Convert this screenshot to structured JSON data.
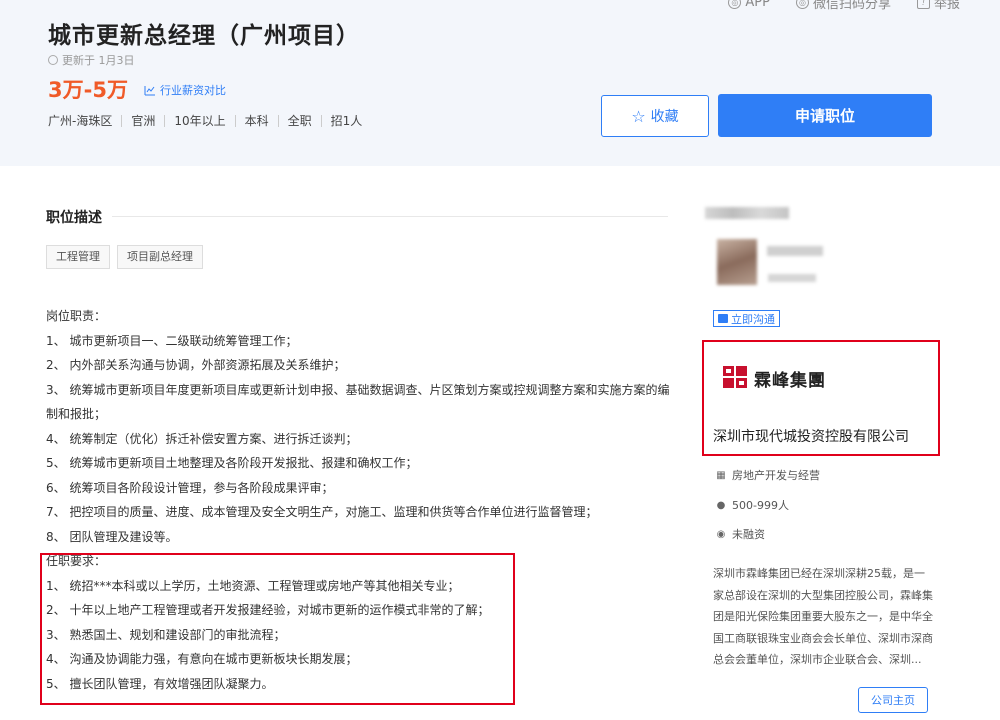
{
  "top_actions": {
    "app": "APP",
    "wechat_share": "微信扫码分享",
    "report": "举报"
  },
  "job": {
    "title": "城市更新总经理（广州项目）",
    "updated": "更新于 1月3日",
    "salary": "3万-5万",
    "salary_compare": "行业薪资对比",
    "attributes": [
      "广州-海珠区",
      "官洲",
      "10年以上",
      "本科",
      "全职",
      "招1人"
    ]
  },
  "buttons": {
    "favorite": "收藏",
    "apply": "申请职位"
  },
  "description": {
    "section_title": "职位描述",
    "keywords": [
      "工程管理",
      "项目副总经理"
    ],
    "duties_heading": "岗位职责：",
    "duties": [
      "1、 城市更新项目一、二级联动统筹管理工作；",
      "2、 内外部关系沟通与协调，外部资源拓展及关系维护；",
      "3、 统筹城市更新项目年度更新项目库或更新计划申报、基础数据调查、片区策划方案或控规调整方案和实施方案的编制和报批；",
      "4、 统筹制定（优化）拆迁补偿安置方案、进行拆迁谈判；",
      "5、 统筹城市更新项目土地整理及各阶段开发报批、报建和确权工作；",
      "6、 统筹项目各阶段设计管理，参与各阶段成果评审；",
      "7、 把控项目的质量、进度、成本管理及安全文明生产，对施工、监理和供货等合作单位进行监督管理；",
      "8、 团队管理及建设等。"
    ],
    "requirements_heading": "任职要求：",
    "requirements": [
      "1、 统招***本科或以上学历，土地资源、工程管理或房地产等其他相关专业；",
      "2、 十年以上地产工程管理或者开发报建经验，对城市更新的运作模式非常的了解；",
      "3、 熟悉国土、规划和建设部门的审批流程；",
      "4、 沟通及协调能力强，有意向在城市更新板块长期发展；",
      "5、 擅长团队管理，有效增强团队凝聚力。"
    ]
  },
  "recruiter": {
    "chat_button": "立即沟通"
  },
  "company": {
    "logo_text": "霖峰集團",
    "name": "深圳市现代城投资控股有限公司",
    "industry": "房地产开发与经营",
    "size": "500-999人",
    "funding": "未融资",
    "intro": "深圳市霖峰集团已经在深圳深耕25载，是一家总部设在深圳的大型集团控股公司，霖峰集团是阳光保险集团重要大股东之一，是中华全国工商联银珠宝业商会会长单位、深圳市深商总会会董单位，深圳市企业联合会、深圳...",
    "home_button": "公司主页"
  },
  "colors": {
    "accent": "#2f7ef6",
    "salary": "#f05a28",
    "highlight_box": "#e0001b",
    "header_bg": "#f3f6fb"
  }
}
